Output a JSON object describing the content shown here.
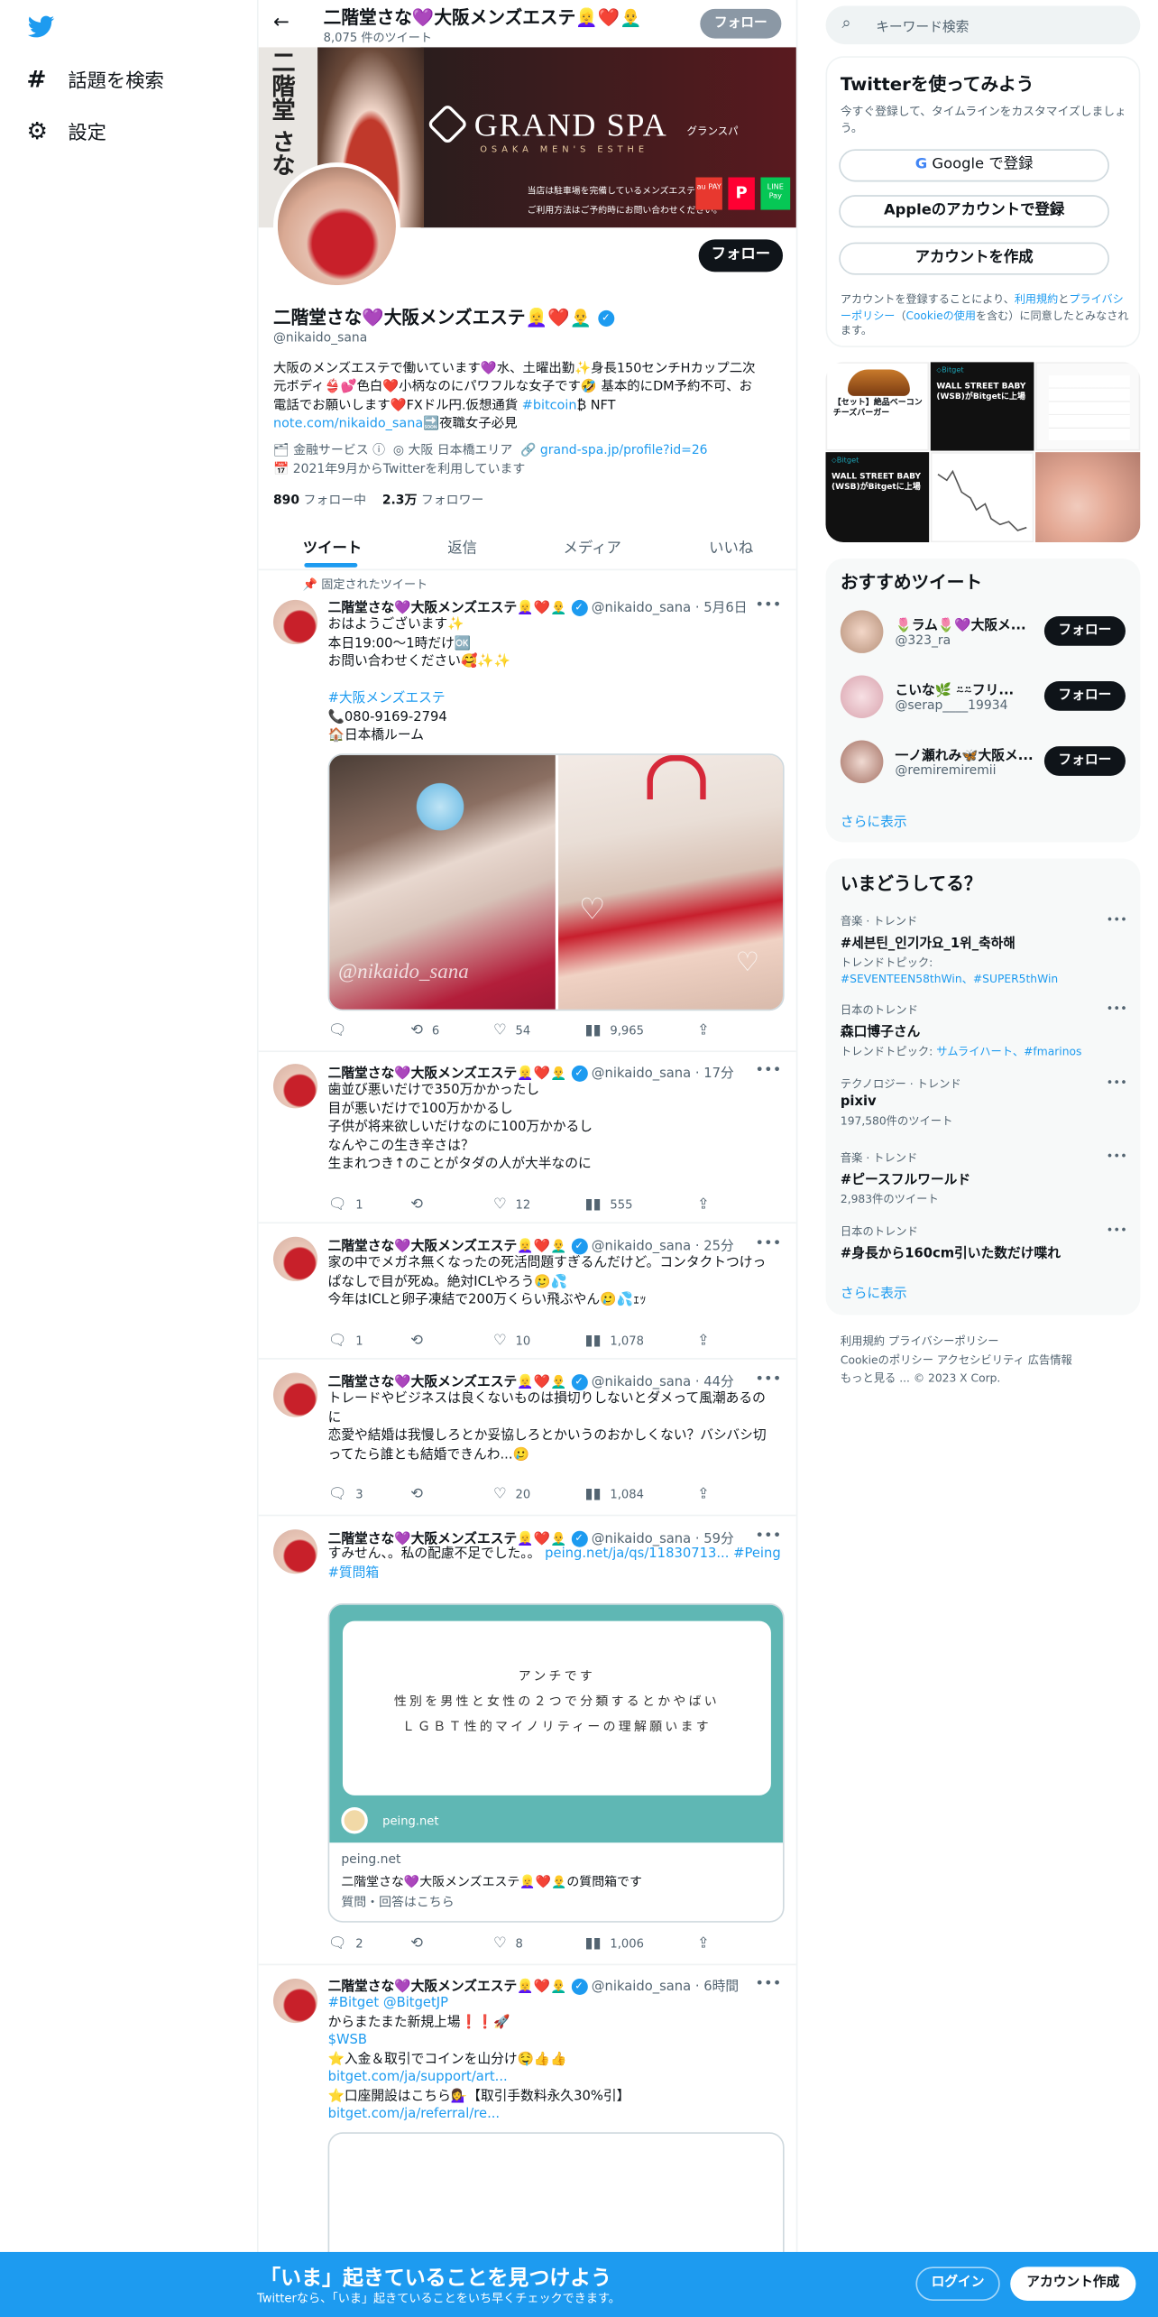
{
  "nav": {
    "explore": "話題を検索",
    "settings": "設定"
  },
  "header": {
    "name": "二階堂さな💜大阪メンズエステ👱‍♀️❤️👨‍🦲",
    "tweet_count": "8,075 件のツイート",
    "follow": "フォロー"
  },
  "banner": {
    "brand": "GRAND SPA",
    "sub": "OSAKA MEN'S ESTHE",
    "katakana": "グランスパ",
    "side_text": "二階堂 さな",
    "line1": "当店は駐車場を完備しているメンズエステです。",
    "line2": "ご利用方法はご予約時にお問い合わせください。",
    "pay": [
      "au PAY",
      "P",
      "LINE Pay"
    ]
  },
  "profile": {
    "follow": "フォロー",
    "name": "二階堂さな💜大阪メンズエステ👱‍♀️❤️👨‍🦲",
    "handle": "@nikaido_sana",
    "bio1": "大阪のメンズエステで働いています💜水、土曜出勤✨身長150センチHカップ二次",
    "bio2": "元ボディ👙💕色白❤️小柄なのにパワフルな女子です🤣 基本的にDM予約不可、お",
    "bio3a": "電話でお願いします❤️FXドル円.仮想通貨 ",
    "bio3b": "#bitcoin",
    "bio3c": "₿ NFT",
    "bio4a": "note.com/nikaido_sana",
    "bio4b": "🔜夜職女子必見",
    "category": "金融サービス",
    "location": "大阪 日本橋エリア",
    "website": "grand-spa.jp/profile?id=26",
    "joined": "2021年9月からTwitterを利用しています",
    "following_count": "890",
    "following_label": "フォロー中",
    "followers_count": "2.3万",
    "followers_label": "フォロワー"
  },
  "tabs": [
    "ツイート",
    "返信",
    "メディア",
    "いいね"
  ],
  "pinned_label": "固定されたツイート",
  "tweets": [
    {
      "name": "二階堂さな💜大阪メンズエステ👱‍♀️❤️👨‍🦲",
      "handle": "@nikaido_sana",
      "time": "5月6日",
      "lines": [
        "おはようございます✨",
        "本日19:00〜1時だけ🆗",
        "お問い合わせください🥰✨✨",
        "",
        "#大阪メンズエステ",
        "📞080-9169-2794",
        "🏠日本橋ルーム"
      ],
      "replies": "",
      "retweets": "6",
      "likes": "54",
      "views": "9,965",
      "watermark": "@nikaido_sana"
    },
    {
      "name": "二階堂さな💜大阪メンズエステ👱‍♀️❤️👨‍🦲",
      "handle": "@nikaido_sana",
      "time": "17分",
      "lines": [
        "歯並び悪いだけで350万かかったし",
        "目が悪いだけで100万かかるし",
        "子供が将来欲しいだけなのに100万かかるし",
        "なんやこの生き辛さは？",
        "生まれつき↑のことがタダの人が大半なのに"
      ],
      "replies": "1",
      "retweets": "",
      "likes": "12",
      "views": "555"
    },
    {
      "name": "二階堂さな💜大阪メンズエステ👱‍♀️❤️👨‍🦲",
      "handle": "@nikaido_sana",
      "time": "25分",
      "lines": [
        "家の中でメガネ無くなったの死活問題すぎるんだけど。コンタクトつけっ",
        "ぱなしで目が死ぬ。絶対ICLやろう🥲💦",
        "今年はICLと卵子凍結で200万くらい飛ぶやん🥲💦ｪｯ"
      ],
      "replies": "1",
      "retweets": "",
      "likes": "10",
      "views": "1,078"
    },
    {
      "name": "二階堂さな💜大阪メンズエステ👱‍♀️❤️👨‍🦲",
      "handle": "@nikaido_sana",
      "time": "44分",
      "lines": [
        "トレードやビジネスは良くないものは損切りしないとダメって風潮あるの",
        "に",
        "恋愛や結婚は我慢しろとか妥協しろとかいうのおかしくない？バシバシ切",
        "ってたら誰とも結婚できんわ...🥲"
      ],
      "replies": "3",
      "retweets": "",
      "likes": "20",
      "views": "1,084"
    },
    {
      "name": "二階堂さな💜大阪メンズエステ👱‍♀️❤️👨‍🦲",
      "handle": "@nikaido_sana",
      "time": "59分",
      "text_a": "すみせん、。私の配慮不足でした。。",
      "link_a": "peing.net/ja/qs/11830713...",
      "tag_a": "#Peing",
      "tag_b": "#質問箱",
      "card_lines": [
        "アンチです",
        "性別を男性と女性の２つで分類するとかやばい",
        "ＬＧＢＴ性的マイノリティーの理解願います"
      ],
      "card_site": "peing.net",
      "card_domain": "peing.net",
      "card_title": "二階堂さな💜大阪メンズエステ👱‍♀️❤️👨‍🦲の質問箱です",
      "card_desc": "質問・回答はこちら",
      "replies": "2",
      "retweets": "",
      "likes": "8",
      "views": "1,006"
    },
    {
      "name": "二階堂さな💜大阪メンズエステ👱‍♀️❤️👨‍🦲",
      "handle": "@nikaido_sana",
      "time": "6時間",
      "tag1": "#Bitget",
      "tag2": "@BitgetJP",
      "line2": "からまたまた新規上場❗️❗️🚀",
      "cash": "$WSB",
      "line4": "⭐入金＆取引でコインを山分け🤤👍👍",
      "link1": "bitget.com/ja/support/art...",
      "line6": "⭐口座開設はこちら💁‍♀️【取引手数料永久30%引】",
      "link2": "bitget.com/ja/referral/re..."
    }
  ],
  "search": {
    "placeholder": "キーワード検索"
  },
  "signup": {
    "title": "Twitterを使ってみよう",
    "sub": "今すぐ登録して、タイムラインをカスタマイズしましょう。",
    "google": "Google で登録",
    "apple": "Appleのアカウントで登録",
    "create": "アカウントを作成",
    "terms_a": "アカウントを登録することにより、",
    "terms_link1": "利用規約",
    "terms_b": "と",
    "terms_link2": "プライバシーポリシー",
    "terms_c": "（",
    "terms_link3": "Cookieの使用",
    "terms_d": "を含む）に同意したとみなされます。"
  },
  "media_grid": {
    "tile1": "【セット】絶品ベーコンチーズバーガー",
    "tile2": "WALL STREET BABY (WSB)がBitgetに上場",
    "tile4": "WALL STREET BABY (WSB)がBitgetに上場"
  },
  "recommend": {
    "title": "おすすめツイート",
    "follow": "フォロー",
    "users": [
      {
        "name": "🌷ラム🌷💜大阪メ...",
        "handle": "@323_ra"
      },
      {
        "name": "こいな🌿 ⍨⍨フリ...",
        "handle": "@serap____19934"
      },
      {
        "name": "一ノ瀬れみ🦋大阪メ...",
        "handle": "@remiremiremii"
      }
    ],
    "more": "さらに表示"
  },
  "trends": {
    "title": "いまどうしてる？",
    "items": [
      {
        "cat": "音楽 · トレンド",
        "name": "#세븐틴_인기가요_1위_축하해",
        "sub_label": "トレンドトピック: ",
        "links": "#SEVENTEEN58thWin、#SUPER5thWin"
      },
      {
        "cat": "日本のトレンド",
        "name": "森口博子さん",
        "sub_label": "トレンドトピック: ",
        "links": "サムライハート、#fmarinos"
      },
      {
        "cat": "テクノロジー · トレンド",
        "name": "pixiv",
        "sub": "197,580件のツイート"
      },
      {
        "cat": "音楽 · トレンド",
        "name": "#ピースフルワールド",
        "sub": "2,983件のツイート"
      },
      {
        "cat": "日本のトレンド",
        "name": "#身長から160cm引いた数だけ喋れ"
      }
    ],
    "more": "さらに表示"
  },
  "footer": {
    "l1": "利用規約 プライバシーポリシー",
    "l2": "Cookieのポリシー アクセシビリティ 広告情報",
    "l3": "もっと見る ...  © 2023 X Corp."
  },
  "bottom": {
    "title": "「いま」起きていることを見つけよう",
    "sub": "Twitterなら、「いま」起きていることをいち早くチェックできます。",
    "login": "ログイン",
    "signup": "アカウント作成"
  }
}
